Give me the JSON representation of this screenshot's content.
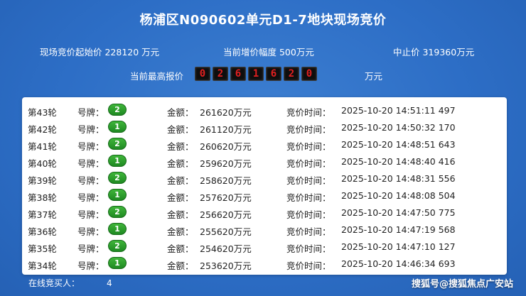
{
  "title": "杨浦区N090602单元D1-7地块现场竞价",
  "info": {
    "start_price": "现场竞价起始价 228120 万元",
    "increment": "当前增价幅度 500万元",
    "stop_price": "中止价 319360万元"
  },
  "top_bid": {
    "label": "当前最高报价",
    "digits": [
      "0",
      "2",
      "6",
      "1",
      "6",
      "2",
      "0"
    ],
    "unit": "万元"
  },
  "labels": {
    "plate": "号牌：",
    "amount": "金额：",
    "time": "竞价时间："
  },
  "bids": [
    {
      "round": "第43轮",
      "plate": "2",
      "amount": "261620万元",
      "time": "2025-10-20 14:51:11 497"
    },
    {
      "round": "第42轮",
      "plate": "1",
      "amount": "261120万元",
      "time": "2025-10-20 14:50:32 170"
    },
    {
      "round": "第41轮",
      "plate": "2",
      "amount": "260620万元",
      "time": "2025-10-20 14:48:51 643"
    },
    {
      "round": "第40轮",
      "plate": "1",
      "amount": "259620万元",
      "time": "2025-10-20 14:48:40 416"
    },
    {
      "round": "第39轮",
      "plate": "2",
      "amount": "258620万元",
      "time": "2025-10-20 14:48:31 556"
    },
    {
      "round": "第38轮",
      "plate": "1",
      "amount": "257620万元",
      "time": "2025-10-20 14:48:08 504"
    },
    {
      "round": "第37轮",
      "plate": "2",
      "amount": "256620万元",
      "time": "2025-10-20 14:47:50 775"
    },
    {
      "round": "第36轮",
      "plate": "1",
      "amount": "255620万元",
      "time": "2025-10-20 14:47:19 568"
    },
    {
      "round": "第35轮",
      "plate": "2",
      "amount": "254620万元",
      "time": "2025-10-20 14:47:10 127"
    },
    {
      "round": "第34轮",
      "plate": "1",
      "amount": "253620万元",
      "time": "2025-10-20 14:46:34 693"
    }
  ],
  "footer": {
    "label": "在线竞买人：",
    "count": "4"
  },
  "watermark": "搜狐号@搜狐焦点广安站",
  "colors": {
    "background": "#2d6ec6",
    "badge": "#2e9f2c",
    "digit_bg": "#0e0e0e",
    "digit_fg": "#e02020"
  }
}
